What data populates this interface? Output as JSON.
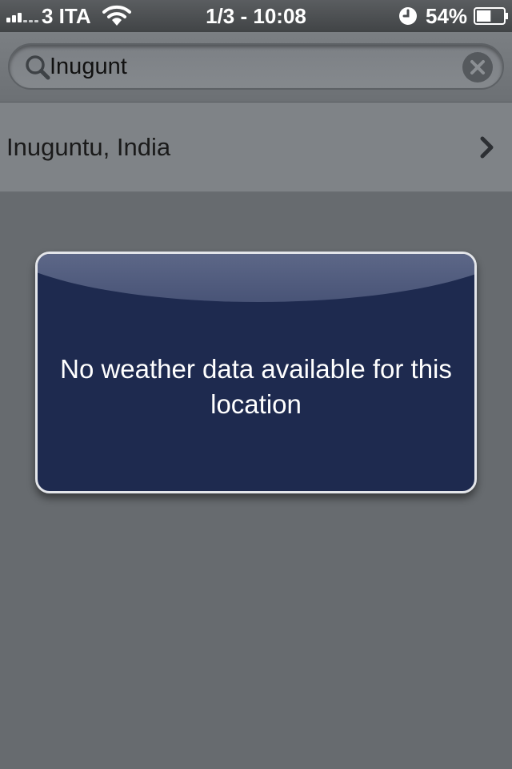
{
  "status_bar": {
    "carrier": "3 ITA",
    "datetime": "1/3 - 10:08",
    "battery_percent": "54%",
    "battery_level": 0.54,
    "signal_bars": 3,
    "icons": [
      "signal-icon",
      "wifi-icon",
      "alarm-icon",
      "battery-icon"
    ]
  },
  "search": {
    "value": "Inugunt",
    "icon": "search-icon",
    "clear_icon": "clear-icon"
  },
  "results": [
    {
      "label": "Inuguntu, India",
      "icon": "chevron-right-icon"
    }
  ],
  "alert": {
    "message": "No weather data available for this location"
  },
  "colors": {
    "background": "#676b6f",
    "alert_background": "#1e2a4f",
    "alert_border": "#e4e6ea",
    "text_dark": "#1a1a1a",
    "text_light": "#ffffff"
  }
}
